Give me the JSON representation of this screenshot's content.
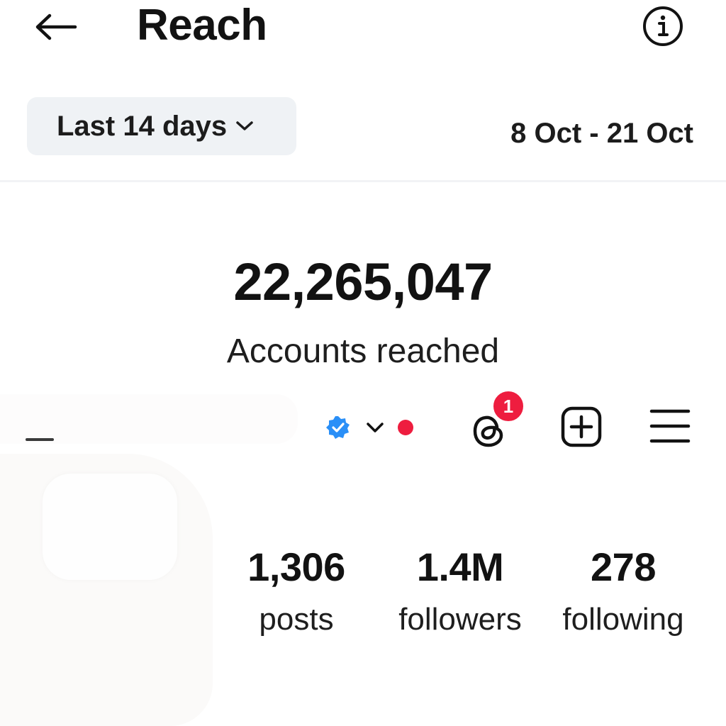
{
  "header": {
    "title": "Reach",
    "back_icon": "arrow-left-icon",
    "info_icon": "info-circle-icon"
  },
  "range": {
    "selected": "Last 14 days",
    "dates": "8 Oct - 21 Oct"
  },
  "metric": {
    "value": "22,265,047",
    "label": "Accounts reached"
  },
  "profile": {
    "notification_count": "1",
    "icons": [
      "verified-badge-icon",
      "chevron-down-icon",
      "threads-icon",
      "add-post-icon",
      "hamburger-menu-icon"
    ],
    "colors": {
      "verified": "#2a8ff7",
      "alert": "#ee1d3f"
    },
    "stats": [
      {
        "value": "1,306",
        "label": "posts"
      },
      {
        "value": "1.4M",
        "label": "followers"
      },
      {
        "value": "278",
        "label": "following"
      }
    ]
  }
}
